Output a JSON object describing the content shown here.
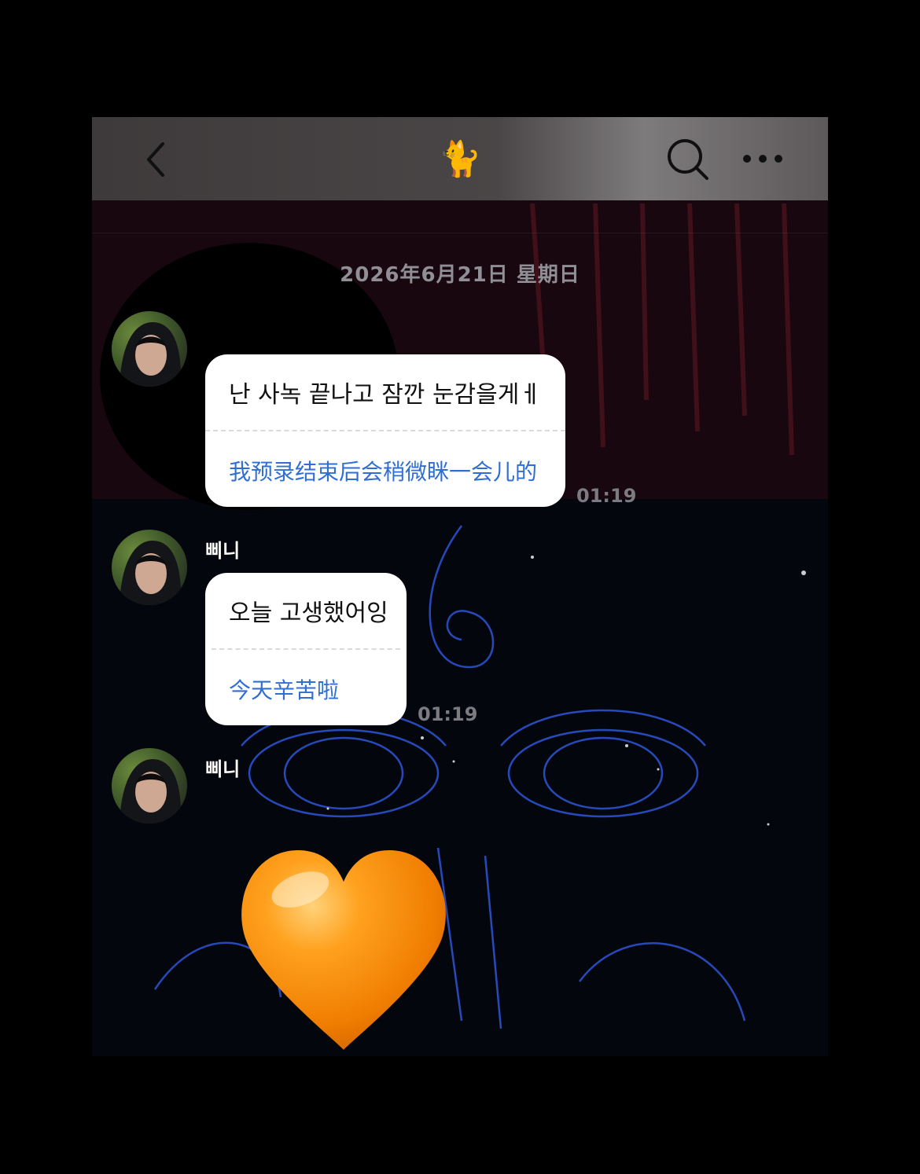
{
  "header": {
    "title_icon": "cat-emoji",
    "title_glyph": "🐈",
    "back_icon": "chevron-left-icon",
    "search_icon": "search-icon",
    "more_icon": "more-horizontal-icon"
  },
  "date_label": "2026年6月21日 星期日",
  "messages": [
    {
      "sender": "",
      "korean": "난 사녹 끝나고 잠깐 눈감을게ㅔ",
      "translation": "我预录结束后会稍微眯一会儿的",
      "time": "01:19"
    },
    {
      "sender": "삐니",
      "korean": "오늘 고생했어잉",
      "translation": "今天辛苦啦",
      "time": "01:19"
    },
    {
      "sender": "삐니",
      "sticker": "orange-heart-emoji"
    }
  ],
  "colors": {
    "translation_text": "#2f6fd4",
    "bubble_bg": "#ffffff",
    "heart": "#f58a07"
  }
}
